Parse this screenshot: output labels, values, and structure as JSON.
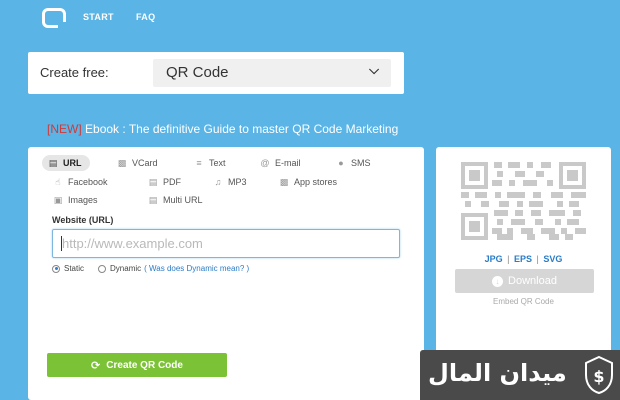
{
  "nav": {
    "start": "START",
    "faq": "FAQ"
  },
  "create": {
    "label": "Create free:",
    "selected": "QR Code"
  },
  "ebook": {
    "tag": "[NEW]",
    "text": "Ebook : The definitive Guide to master QR Code Marketing"
  },
  "tabs": [
    {
      "label": "URL",
      "icon": "link-icon",
      "active": true
    },
    {
      "label": "VCard",
      "icon": "vcard-icon"
    },
    {
      "label": "Text",
      "icon": "text-lines-icon"
    },
    {
      "label": "E-mail",
      "icon": "email-at-icon"
    },
    {
      "label": "SMS",
      "icon": "chat-bubble-icon"
    },
    {
      "label": "Facebook",
      "icon": "thumbs-up-icon"
    },
    {
      "label": "PDF",
      "icon": "pdf-file-icon"
    },
    {
      "label": "MP3",
      "icon": "music-note-icon"
    },
    {
      "label": "App stores",
      "icon": "app-store-icon"
    },
    {
      "label": "Images",
      "icon": "image-icon"
    },
    {
      "label": "Multi URL",
      "icon": "multi-link-icon"
    }
  ],
  "form": {
    "website_label": "Website (URL)",
    "website_placeholder": "http://www.example.com",
    "static_label": "Static",
    "dynamic_label": "Dynamic",
    "dynamic_link": "( Was does Dynamic mean? )",
    "mode_selected": "Static"
  },
  "create_button": "Create QR Code",
  "formats": {
    "jpg": "JPG",
    "sep": "|",
    "eps": "EPS",
    "svg": "SVG"
  },
  "download_button": "Download",
  "embed_link": "Embed QR Code",
  "watermark": {
    "text": "ميدان المال"
  },
  "colors": {
    "background": "#5ab4e6",
    "green_button": "#7cc237",
    "link_blue": "#2a7cc7",
    "new_tag_red": "#d03a3a",
    "disabled_gray": "#d6d6d6"
  }
}
